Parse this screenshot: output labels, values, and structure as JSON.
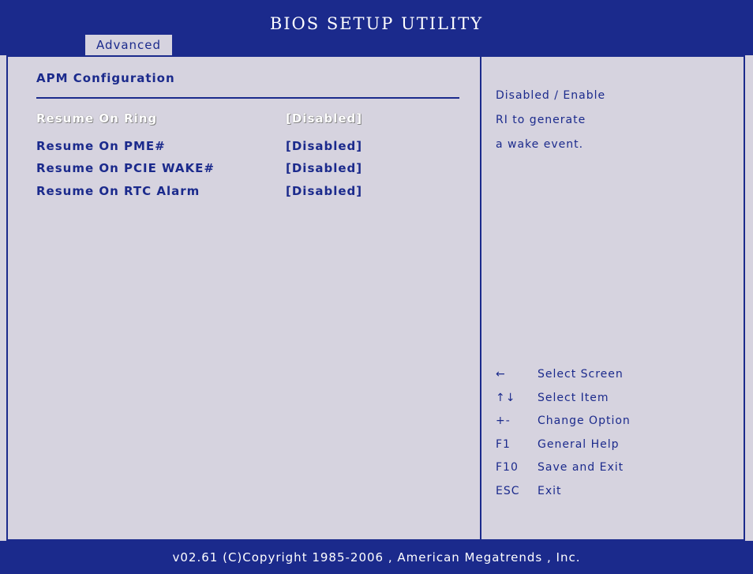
{
  "header": {
    "title": "BIOS SETUP UTILITY",
    "active_tab": "Advanced"
  },
  "main": {
    "section_title": "APM Configuration",
    "items": [
      {
        "label": "Resume On Ring",
        "value": "[Disabled]",
        "selected": true
      },
      {
        "label": "Resume On PME#",
        "value": "[Disabled]",
        "selected": false
      },
      {
        "label": "Resume On PCIE WAKE#",
        "value": "[Disabled]",
        "selected": false
      },
      {
        "label": "Resume On RTC Alarm",
        "value": "[Disabled]",
        "selected": false
      }
    ]
  },
  "help": {
    "lines": [
      "Disabled / Enable",
      "RI to generate",
      "a wake event."
    ]
  },
  "keys": [
    {
      "key": "←",
      "desc": "Select Screen"
    },
    {
      "key": "↑↓",
      "desc": "Select Item"
    },
    {
      "key": "+-",
      "desc": "Change Option"
    },
    {
      "key": "F1",
      "desc": "General Help"
    },
    {
      "key": "F10",
      "desc": "Save and Exit"
    },
    {
      "key": "ESC",
      "desc": "Exit"
    }
  ],
  "footer": {
    "text": "v02.61  (C)Copyright 1985-2006 , American Megatrends , Inc."
  },
  "colors": {
    "bar": "#1b2a8c",
    "panel": "#d6d3df",
    "selected_text": "#ffffff"
  }
}
